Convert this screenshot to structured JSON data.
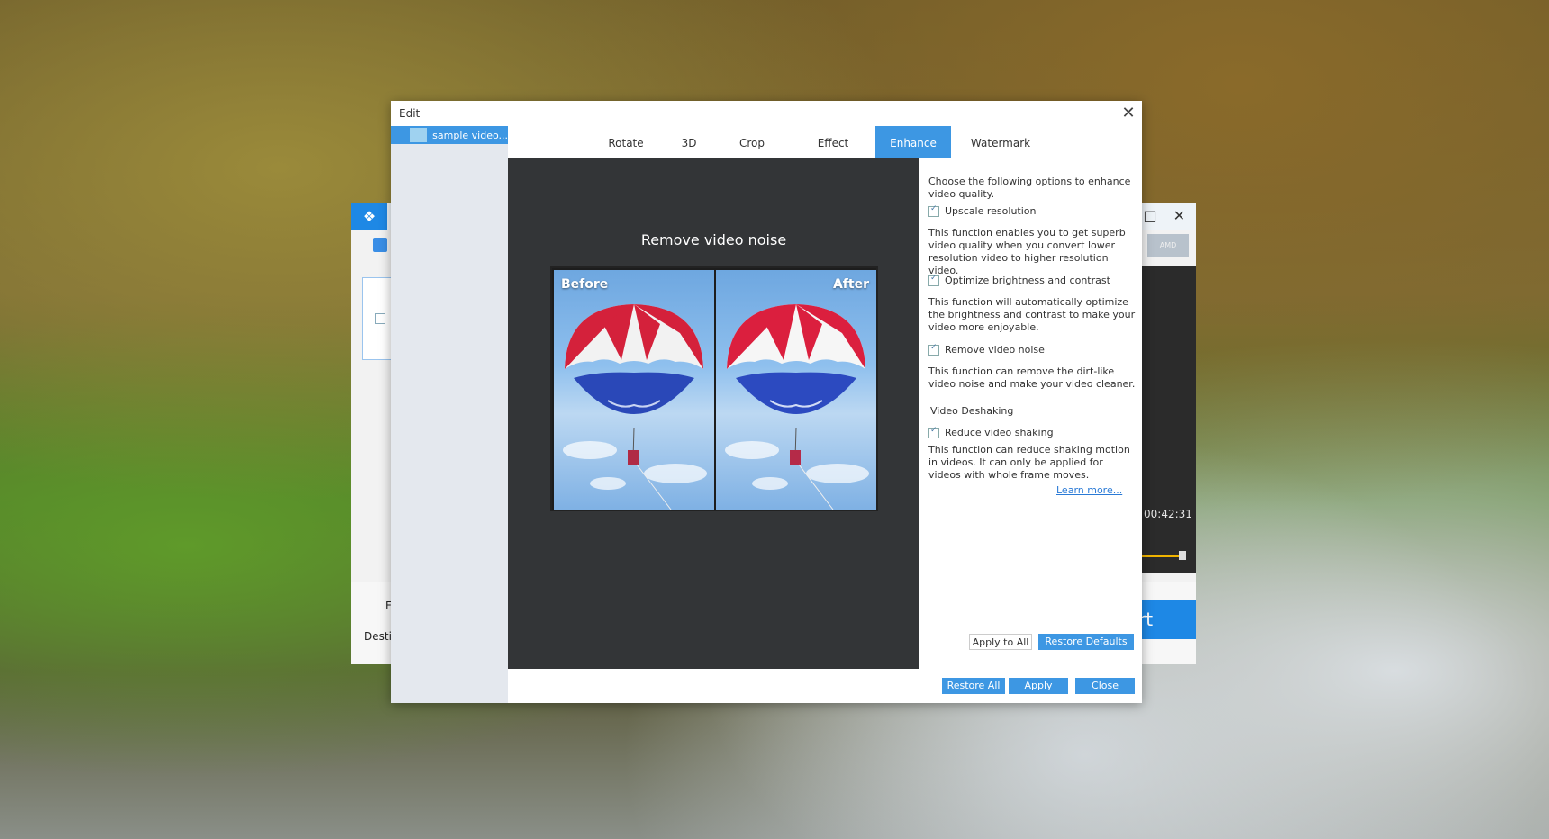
{
  "background_app": {
    "time": "00:42:31",
    "badge": "AMD",
    "label_f": "F",
    "label_destination": "Desti",
    "convert_label": "rt"
  },
  "dialog": {
    "title": "Edit",
    "close_glyph": "✕",
    "file_item": "sample video...",
    "tabs": [
      {
        "label": "Rotate"
      },
      {
        "label": "3D"
      },
      {
        "label": "Crop"
      },
      {
        "label": "Effect"
      },
      {
        "label": "Enhance",
        "active": true
      },
      {
        "label": "Watermark"
      }
    ],
    "preview": {
      "title": "Remove video noise",
      "before_label": "Before",
      "after_label": "After"
    },
    "options": {
      "intro": "Choose the following options to enhance video quality.",
      "upscale_label": "Upscale resolution",
      "upscale_desc": "This function enables you to get superb video quality when you convert lower resolution video to higher resolution video.",
      "brightness_label": "Optimize brightness and contrast",
      "brightness_desc": "This function will automatically optimize the brightness and contrast to make your video more enjoyable.",
      "noise_label": "Remove video noise",
      "noise_desc": "This function can remove the dirt-like video noise and make your video cleaner.",
      "deshake_section": "Video Deshaking",
      "deshake_label": "Reduce video shaking",
      "deshake_desc": "This function can reduce shaking motion in videos. It can only be applied for videos with whole frame moves.",
      "learn_more": "Learn more..."
    },
    "buttons": {
      "apply_to_all": "Apply to All",
      "restore_defaults": "Restore Defaults",
      "restore_all": "Restore All",
      "apply": "Apply",
      "close": "Close"
    }
  },
  "colors": {
    "accent": "#3d97e3",
    "preview_bg": "#333537"
  }
}
